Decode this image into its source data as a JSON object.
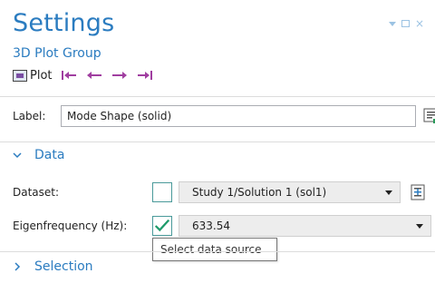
{
  "header": {
    "title": "Settings",
    "subtitle": "3D Plot Group"
  },
  "toolbar": {
    "plot_label": "Plot",
    "icons": [
      "plot-icon",
      "first-icon",
      "previous-icon",
      "next-icon",
      "last-icon"
    ]
  },
  "label_field": {
    "label": "Label:",
    "value": "Mode Shape (solid)"
  },
  "sections": {
    "data": "Data",
    "selection": "Selection"
  },
  "dataset": {
    "label": "Dataset:",
    "value": "Study 1/Solution 1 (sol1)",
    "checked": false
  },
  "eigenfrequency": {
    "label": "Eigenfrequency (Hz):",
    "value": "633.54",
    "checked": true
  },
  "tooltip": {
    "text": "Select data source"
  },
  "colors": {
    "accent": "#2b7cc0",
    "nav_arrows": "#a03ea0",
    "checkbox_border": "#4a9a9a",
    "checkmark": "#1e9b6b"
  }
}
